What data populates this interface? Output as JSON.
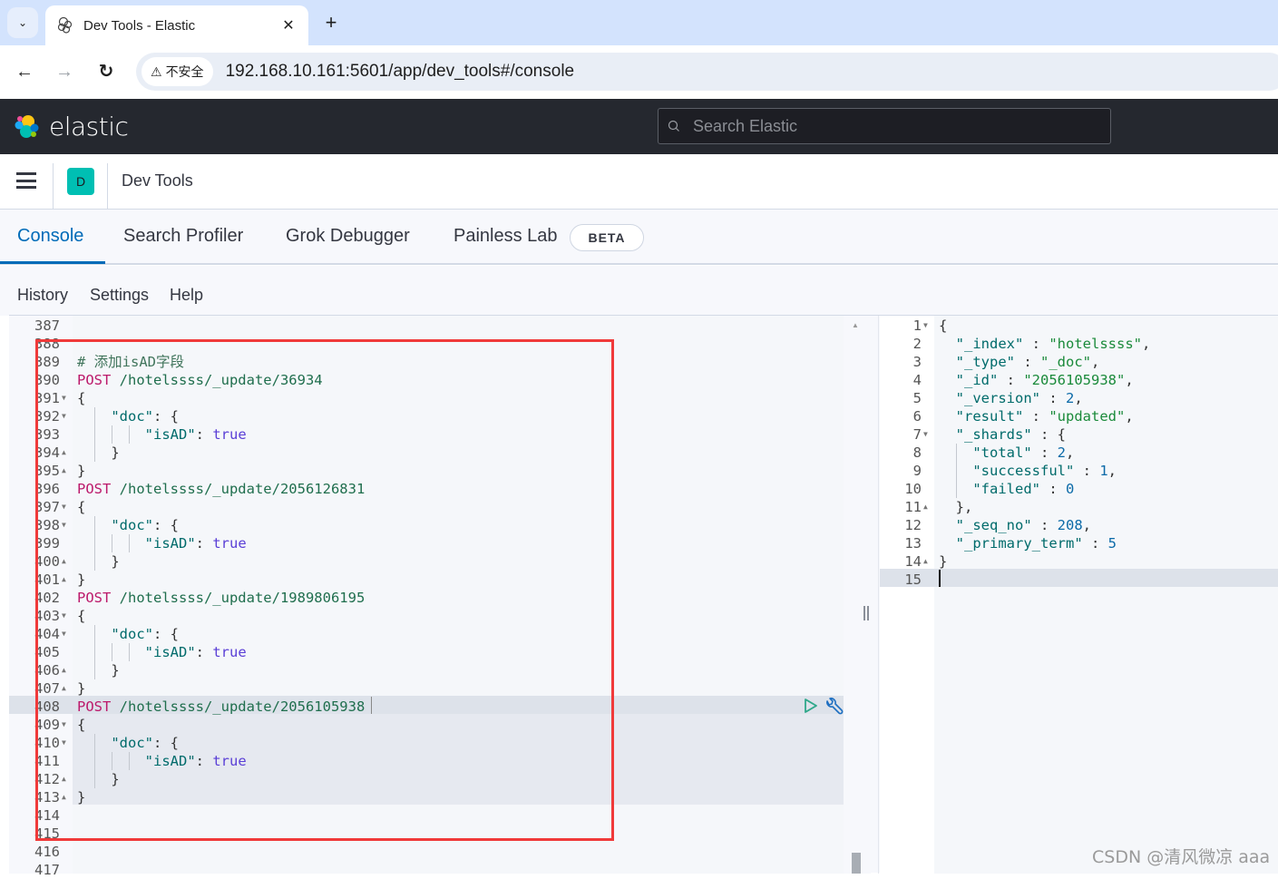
{
  "browser": {
    "tab_title": "Dev Tools - Elastic",
    "tab_close": "✕",
    "new_tab": "+",
    "tab_list_icon": "⌄",
    "back": "←",
    "forward": "→",
    "reload": "↻",
    "security_label": "不安全",
    "security_icon": "⚠",
    "url": "192.168.10.161:5601/app/dev_tools#/console"
  },
  "header": {
    "brand": "elastic",
    "search_placeholder": "Search Elastic"
  },
  "breadcrumb": {
    "app_badge": "D",
    "title": "Dev Tools"
  },
  "tabs": [
    {
      "label": "Console",
      "active": true
    },
    {
      "label": "Search Profiler",
      "active": false
    },
    {
      "label": "Grok Debugger",
      "active": false
    },
    {
      "label": "Painless Lab",
      "active": false
    }
  ],
  "beta_badge": "BETA",
  "menu": [
    "History",
    "Settings",
    "Help"
  ],
  "request_editor": {
    "lines": [
      {
        "n": "387",
        "fold": "",
        "tokens": []
      },
      {
        "n": "388",
        "fold": "",
        "tokens": []
      },
      {
        "n": "389",
        "fold": "",
        "tokens": [
          {
            "t": "# 添加isAD字段",
            "c": "comment"
          }
        ]
      },
      {
        "n": "390",
        "fold": "",
        "tokens": [
          {
            "t": "POST",
            "c": "method"
          },
          {
            "t": " /hotelssss/_update/36934",
            "c": "url"
          }
        ]
      },
      {
        "n": "391",
        "fold": "▾",
        "tokens": [
          {
            "t": "{",
            "c": "punc"
          }
        ]
      },
      {
        "n": "392",
        "fold": "▾",
        "tokens": [
          {
            "t": "    ",
            "c": "punc"
          },
          {
            "t": "\"doc\"",
            "c": "key"
          },
          {
            "t": ": {",
            "c": "punc"
          }
        ]
      },
      {
        "n": "393",
        "fold": "",
        "tokens": [
          {
            "t": "        ",
            "c": "punc"
          },
          {
            "t": "\"isAD\"",
            "c": "key"
          },
          {
            "t": ": ",
            "c": "punc"
          },
          {
            "t": "true",
            "c": "bool"
          }
        ]
      },
      {
        "n": "394",
        "fold": "▴",
        "tokens": [
          {
            "t": "    }",
            "c": "punc"
          }
        ]
      },
      {
        "n": "395",
        "fold": "▴",
        "tokens": [
          {
            "t": "}",
            "c": "punc"
          }
        ]
      },
      {
        "n": "396",
        "fold": "",
        "tokens": [
          {
            "t": "POST",
            "c": "method"
          },
          {
            "t": " /hotelssss/_update/2056126831",
            "c": "url"
          }
        ]
      },
      {
        "n": "397",
        "fold": "▾",
        "tokens": [
          {
            "t": "{",
            "c": "punc"
          }
        ]
      },
      {
        "n": "398",
        "fold": "▾",
        "tokens": [
          {
            "t": "    ",
            "c": "punc"
          },
          {
            "t": "\"doc\"",
            "c": "key"
          },
          {
            "t": ": {",
            "c": "punc"
          }
        ]
      },
      {
        "n": "399",
        "fold": "",
        "tokens": [
          {
            "t": "        ",
            "c": "punc"
          },
          {
            "t": "\"isAD\"",
            "c": "key"
          },
          {
            "t": ": ",
            "c": "punc"
          },
          {
            "t": "true",
            "c": "bool"
          }
        ]
      },
      {
        "n": "400",
        "fold": "▴",
        "tokens": [
          {
            "t": "    }",
            "c": "punc"
          }
        ]
      },
      {
        "n": "401",
        "fold": "▴",
        "tokens": [
          {
            "t": "}",
            "c": "punc"
          }
        ]
      },
      {
        "n": "402",
        "fold": "",
        "tokens": [
          {
            "t": "POST",
            "c": "method"
          },
          {
            "t": " /hotelssss/_update/1989806195",
            "c": "url"
          }
        ]
      },
      {
        "n": "403",
        "fold": "▾",
        "tokens": [
          {
            "t": "{",
            "c": "punc"
          }
        ]
      },
      {
        "n": "404",
        "fold": "▾",
        "tokens": [
          {
            "t": "    ",
            "c": "punc"
          },
          {
            "t": "\"doc\"",
            "c": "key"
          },
          {
            "t": ": {",
            "c": "punc"
          }
        ]
      },
      {
        "n": "405",
        "fold": "",
        "tokens": [
          {
            "t": "        ",
            "c": "punc"
          },
          {
            "t": "\"isAD\"",
            "c": "key"
          },
          {
            "t": ": ",
            "c": "punc"
          },
          {
            "t": "true",
            "c": "bool"
          }
        ]
      },
      {
        "n": "406",
        "fold": "▴",
        "tokens": [
          {
            "t": "    }",
            "c": "punc"
          }
        ]
      },
      {
        "n": "407",
        "fold": "▴",
        "tokens": [
          {
            "t": "}",
            "c": "punc"
          }
        ]
      },
      {
        "n": "408",
        "fold": "",
        "tokens": [
          {
            "t": "POST",
            "c": "method"
          },
          {
            "t": " /hotelssss/_update/2056105938",
            "c": "url"
          }
        ]
      },
      {
        "n": "409",
        "fold": "▾",
        "tokens": [
          {
            "t": "{",
            "c": "punc"
          }
        ]
      },
      {
        "n": "410",
        "fold": "▾",
        "tokens": [
          {
            "t": "    ",
            "c": "punc"
          },
          {
            "t": "\"doc\"",
            "c": "key"
          },
          {
            "t": ": {",
            "c": "punc"
          }
        ]
      },
      {
        "n": "411",
        "fold": "",
        "tokens": [
          {
            "t": "        ",
            "c": "punc"
          },
          {
            "t": "\"isAD\"",
            "c": "key"
          },
          {
            "t": ": ",
            "c": "punc"
          },
          {
            "t": "true",
            "c": "bool"
          }
        ]
      },
      {
        "n": "412",
        "fold": "▴",
        "tokens": [
          {
            "t": "    }",
            "c": "punc"
          }
        ]
      },
      {
        "n": "413",
        "fold": "▴",
        "tokens": [
          {
            "t": "}",
            "c": "punc"
          }
        ]
      },
      {
        "n": "414",
        "fold": "",
        "tokens": []
      },
      {
        "n": "415",
        "fold": "",
        "tokens": []
      },
      {
        "n": "416",
        "fold": "",
        "tokens": []
      },
      {
        "n": "417",
        "fold": "",
        "tokens": []
      }
    ]
  },
  "response_editor": {
    "lines": [
      {
        "n": "1",
        "fold": "▾",
        "tokens": [
          {
            "t": "{",
            "c": "punc"
          }
        ]
      },
      {
        "n": "2",
        "fold": "",
        "tokens": [
          {
            "t": "  ",
            "c": "punc"
          },
          {
            "t": "\"_index\"",
            "c": "key"
          },
          {
            "t": " : ",
            "c": "punc"
          },
          {
            "t": "\"hotelssss\"",
            "c": "str"
          },
          {
            "t": ",",
            "c": "punc"
          }
        ]
      },
      {
        "n": "3",
        "fold": "",
        "tokens": [
          {
            "t": "  ",
            "c": "punc"
          },
          {
            "t": "\"_type\"",
            "c": "key"
          },
          {
            "t": " : ",
            "c": "punc"
          },
          {
            "t": "\"_doc\"",
            "c": "str"
          },
          {
            "t": ",",
            "c": "punc"
          }
        ]
      },
      {
        "n": "4",
        "fold": "",
        "tokens": [
          {
            "t": "  ",
            "c": "punc"
          },
          {
            "t": "\"_id\"",
            "c": "key"
          },
          {
            "t": " : ",
            "c": "punc"
          },
          {
            "t": "\"2056105938\"",
            "c": "str"
          },
          {
            "t": ",",
            "c": "punc"
          }
        ]
      },
      {
        "n": "5",
        "fold": "",
        "tokens": [
          {
            "t": "  ",
            "c": "punc"
          },
          {
            "t": "\"_version\"",
            "c": "key"
          },
          {
            "t": " : ",
            "c": "punc"
          },
          {
            "t": "2",
            "c": "num"
          },
          {
            "t": ",",
            "c": "punc"
          }
        ]
      },
      {
        "n": "6",
        "fold": "",
        "tokens": [
          {
            "t": "  ",
            "c": "punc"
          },
          {
            "t": "\"result\"",
            "c": "key"
          },
          {
            "t": " : ",
            "c": "punc"
          },
          {
            "t": "\"updated\"",
            "c": "str"
          },
          {
            "t": ",",
            "c": "punc"
          }
        ]
      },
      {
        "n": "7",
        "fold": "▾",
        "tokens": [
          {
            "t": "  ",
            "c": "punc"
          },
          {
            "t": "\"_shards\"",
            "c": "key"
          },
          {
            "t": " : {",
            "c": "punc"
          }
        ]
      },
      {
        "n": "8",
        "fold": "",
        "tokens": [
          {
            "t": "    ",
            "c": "punc"
          },
          {
            "t": "\"total\"",
            "c": "key"
          },
          {
            "t": " : ",
            "c": "punc"
          },
          {
            "t": "2",
            "c": "num"
          },
          {
            "t": ",",
            "c": "punc"
          }
        ]
      },
      {
        "n": "9",
        "fold": "",
        "tokens": [
          {
            "t": "    ",
            "c": "punc"
          },
          {
            "t": "\"successful\"",
            "c": "key"
          },
          {
            "t": " : ",
            "c": "punc"
          },
          {
            "t": "1",
            "c": "num"
          },
          {
            "t": ",",
            "c": "punc"
          }
        ]
      },
      {
        "n": "10",
        "fold": "",
        "tokens": [
          {
            "t": "    ",
            "c": "punc"
          },
          {
            "t": "\"failed\"",
            "c": "key"
          },
          {
            "t": " : ",
            "c": "punc"
          },
          {
            "t": "0",
            "c": "num"
          }
        ]
      },
      {
        "n": "11",
        "fold": "▴",
        "tokens": [
          {
            "t": "  },",
            "c": "punc"
          }
        ]
      },
      {
        "n": "12",
        "fold": "",
        "tokens": [
          {
            "t": "  ",
            "c": "punc"
          },
          {
            "t": "\"_seq_no\"",
            "c": "key"
          },
          {
            "t": " : ",
            "c": "punc"
          },
          {
            "t": "208",
            "c": "num"
          },
          {
            "t": ",",
            "c": "punc"
          }
        ]
      },
      {
        "n": "13",
        "fold": "",
        "tokens": [
          {
            "t": "  ",
            "c": "punc"
          },
          {
            "t": "\"_primary_term\"",
            "c": "key"
          },
          {
            "t": " : ",
            "c": "punc"
          },
          {
            "t": "5",
            "c": "num"
          }
        ]
      },
      {
        "n": "14",
        "fold": "▴",
        "tokens": [
          {
            "t": "}",
            "c": "punc"
          }
        ]
      },
      {
        "n": "15",
        "fold": "",
        "tokens": []
      }
    ]
  },
  "watermark": "CSDN @清风微凉 aaa",
  "colors": {
    "accent": "#006bb8",
    "header_bg": "#25282f",
    "app_badge": "#00bfb3",
    "annotation_box": "#f03a3a"
  }
}
